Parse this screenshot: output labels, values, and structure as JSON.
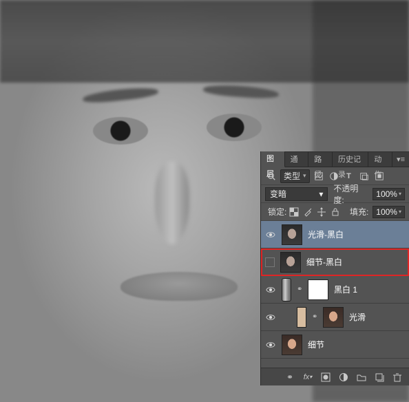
{
  "panel": {
    "tabs": [
      {
        "label": "图层"
      },
      {
        "label": "通道"
      },
      {
        "label": "路径"
      },
      {
        "label": "历史记录"
      },
      {
        "label": "动作"
      }
    ],
    "filter": {
      "label": "类型"
    },
    "blend": {
      "mode": "变暗"
    },
    "opacity": {
      "label": "不透明度:",
      "value": "100%"
    },
    "lock": {
      "label": "锁定:"
    },
    "fill": {
      "label": "填充:",
      "value": "100%"
    },
    "layers": [
      {
        "name": "光滑-黑白",
        "visible": true,
        "selected": true,
        "thumb": "face"
      },
      {
        "name": "细节-黑白",
        "visible": false,
        "highlight": true,
        "thumb": "face"
      },
      {
        "name": "黑白 1",
        "visible": true,
        "thumb": "white",
        "hasMask": true
      },
      {
        "name": "光滑",
        "visible": true,
        "thumb": "face-color"
      },
      {
        "name": "细节",
        "visible": true,
        "thumb": "face-color"
      }
    ],
    "icons": {
      "search": "search-icon",
      "image": "image-icon",
      "adjust": "adjust-icon",
      "text": "text-icon",
      "shape": "shape-icon",
      "smart": "smart-icon",
      "menu": "menu-icon",
      "eye": "eye-icon",
      "link": "link-icon",
      "fx": "fx-icon",
      "mask": "mask-icon",
      "fill": "fill-icon",
      "group": "group-icon",
      "new": "new-icon",
      "trash": "trash-icon"
    }
  }
}
